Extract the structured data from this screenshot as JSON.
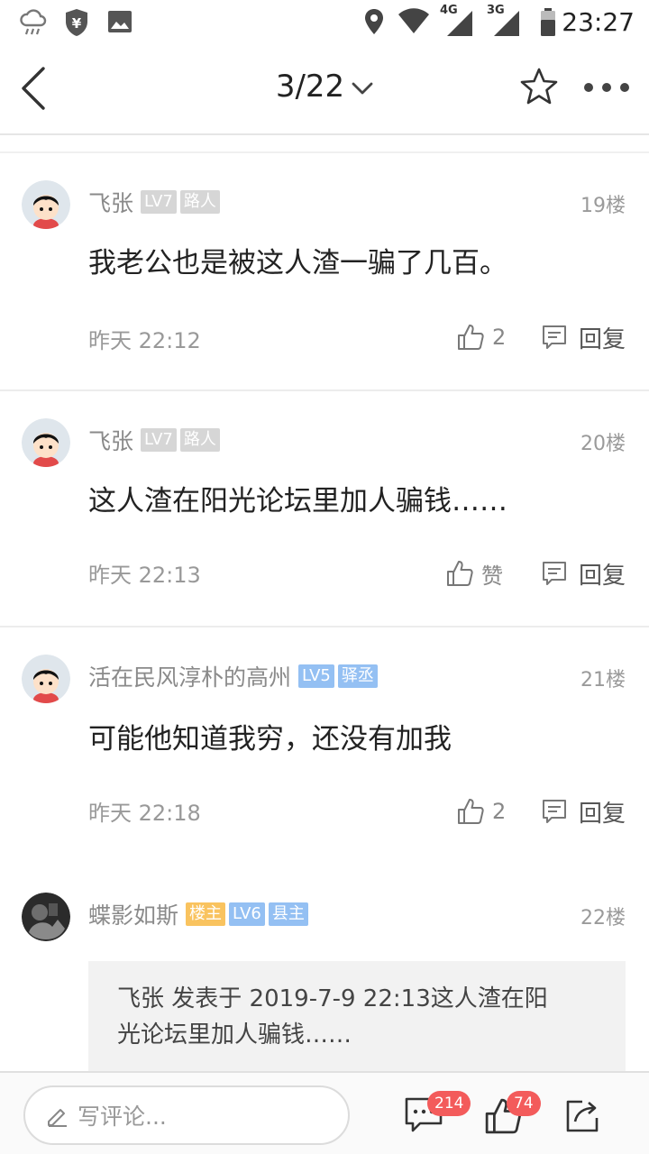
{
  "status_bar": {
    "time": "23:27",
    "net_4g": "4G",
    "net_3g": "3G",
    "icons": [
      "cloud-rain-icon",
      "shield-yen-icon",
      "image-icon",
      "location-icon",
      "wifi-icon",
      "signal-icon",
      "battery-icon"
    ]
  },
  "nav": {
    "page_indicator": "3/22",
    "icons": [
      "back-icon",
      "chevron-down-icon",
      "star-icon",
      "more-icon"
    ]
  },
  "posts": [
    {
      "username": "飞张",
      "badges": [
        "LV7",
        "路人"
      ],
      "floor": "19楼",
      "content": "我老公也是被这人渣一骗了几百。",
      "time": "昨天 22:12",
      "like_label": "2",
      "reply_label": "回复"
    },
    {
      "username": "飞张",
      "badges": [
        "LV7",
        "路人"
      ],
      "floor": "20楼",
      "content": "这人渣在阳光论坛里加人骗钱……",
      "time": "昨天 22:13",
      "like_label": "赞",
      "reply_label": "回复"
    },
    {
      "username": "活在民风淳朴的高州",
      "badges": [
        "LV5",
        "驿丞"
      ],
      "floor": "21楼",
      "content": "可能他知道我穷，还没有加我",
      "time": "昨天 22:18",
      "like_label": "2",
      "reply_label": "回复"
    },
    {
      "username": "蝶影如斯",
      "badges": [
        "楼主",
        "LV6",
        "县主"
      ],
      "floor": "22楼",
      "quote_line1": "飞张 发表于 2019-7-9 22:13这人渣在阳",
      "quote_line2": "光论坛里加人骗钱……"
    }
  ],
  "bottom_bar": {
    "comment_placeholder": "写评论...",
    "comment_count": "214",
    "like_count": "74"
  },
  "colors": {
    "badge_gray": "#d6d6d6",
    "badge_blue": "#94c0f3",
    "badge_orange": "#f9c35f",
    "count_badge_red": "#f35b5b"
  }
}
